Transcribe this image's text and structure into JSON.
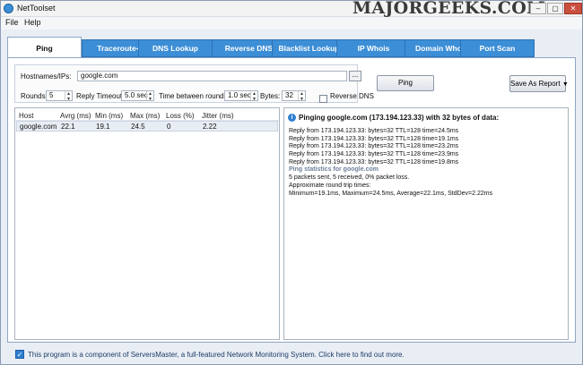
{
  "window": {
    "title": "NetToolset",
    "watermark": "MAJORGEEKS.COM",
    "controls": {
      "minimize": "–",
      "maximize": "▢",
      "close": "✕"
    }
  },
  "menu": {
    "file": "File",
    "help": "Help"
  },
  "tabs": [
    {
      "label": "Ping",
      "active": true
    },
    {
      "label": "Traceroute+",
      "active": false
    },
    {
      "label": "DNS Lookup",
      "active": false
    },
    {
      "label": "Reverse DNS",
      "active": false
    },
    {
      "label": "Blacklist Lookup",
      "active": false
    },
    {
      "label": "IP Whois",
      "active": false
    },
    {
      "label": "Domain Whois",
      "active": false
    },
    {
      "label": "Port Scan",
      "active": false
    }
  ],
  "form": {
    "hostnames_label": "Hostnames/IPs:",
    "hostnames_value": "google.com",
    "browse_label": "...",
    "rounds_label": "Rounds:",
    "rounds_value": "5",
    "reply_timeout_label": "Reply Timeout:",
    "reply_timeout_value": "5.0 sec",
    "between_rounds_label": "Time between rounds:",
    "between_rounds_value": "1.0 sec",
    "bytes_label": "Bytes:",
    "bytes_value": "32",
    "reverse_dns_label": "Reverse DNS",
    "reverse_dns_checked": false
  },
  "actions": {
    "ping": "Ping",
    "save_report": "Save As Report"
  },
  "results": {
    "columns": [
      "Host",
      "Avrg (ms)",
      "Min (ms)",
      "Max (ms)",
      "Loss (%)",
      "Jitter (ms)"
    ],
    "rows": [
      [
        "google.com",
        "22.1",
        "19.1",
        "24.5",
        "0",
        "2.22"
      ]
    ]
  },
  "output": {
    "header": "Pinging google.com (173.194.123.33) with 32 bytes of data:",
    "lines": [
      {
        "text": "Reply from 173.194.123.33: bytes=32 TTL=128 time=24.5ms",
        "style": "normal"
      },
      {
        "text": "Reply from 173.194.123.33: bytes=32 TTL=128 time=19.1ms",
        "style": "normal"
      },
      {
        "text": "Reply from 173.194.123.33: bytes=32 TTL=128 time=23.2ms",
        "style": "normal"
      },
      {
        "text": "Reply from 173.194.123.33: bytes=32 TTL=128 time=23.9ms",
        "style": "normal"
      },
      {
        "text": "Reply from 173.194.123.33: bytes=32 TTL=128 time=19.8ms",
        "style": "normal"
      },
      {
        "text": "Ping statistics for google.com",
        "style": "stat"
      },
      {
        "text": "5 packets sent, 5 received, 0% packet loss.",
        "style": "normal"
      },
      {
        "text": "Approximate round trip times:",
        "style": "normal"
      },
      {
        "text": "Minimum=19.1ms, Maximum=24.5ms, Average=22.1ms, StdDev=2.22ms",
        "style": "normal"
      }
    ]
  },
  "footer": {
    "checked": true,
    "text": "This program is a component of ServersMaster, a full-featured Network Monitoring System. Click here to find out more."
  },
  "colors": {
    "tab_blue": "#3c8ed6",
    "selected_row": "#e8edf4",
    "stat_text": "#6d7f99"
  },
  "icons": {
    "app": "globe-icon",
    "info": "info-icon",
    "dropdown": "triangle-down-icon",
    "check": "checkmark-icon"
  }
}
